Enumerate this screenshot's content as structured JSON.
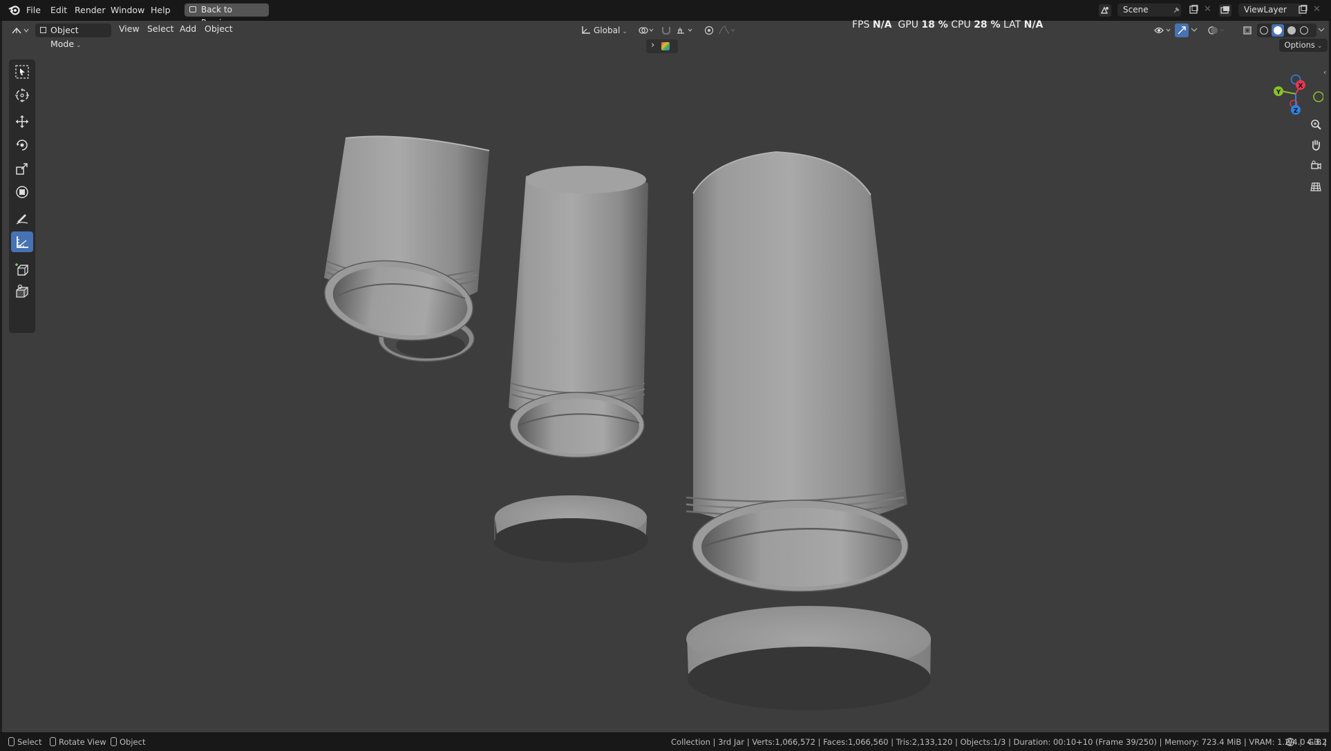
{
  "menubar": {
    "app_icon": "blender-logo-icon",
    "items": [
      "File",
      "Edit",
      "Render",
      "Window",
      "Help"
    ],
    "back_button": "Back to Previous",
    "scene_label": "Scene",
    "view_layer_label": "ViewLayer"
  },
  "viewport_header": {
    "editor_icon": "view3d-editor-icon",
    "mode": "Object Mode",
    "menus": [
      "View",
      "Select",
      "Add",
      "Object"
    ],
    "orientation": "Global",
    "options_label": "Options"
  },
  "stats": {
    "fps_label": "FPS",
    "fps_value": "N/A",
    "gpu_label": "GPU",
    "gpu_value": "18 %",
    "cpu_label": "CPU",
    "cpu_value": "28 %",
    "lat_label": "LAT",
    "lat_value": "N/A"
  },
  "gizmo": {
    "x_label": "X",
    "y_label": "Y",
    "z_label": "Z",
    "x_color": "#e8374f",
    "y_color": "#8bc02b",
    "z_color": "#2f82e0"
  },
  "toolbar": {
    "tools": [
      "select-box-icon",
      "cursor-icon",
      "move-icon",
      "rotate-icon",
      "scale-icon",
      "transform-icon",
      "annotate-icon",
      "measure-icon",
      "add-cube-icon",
      "extrude-icon"
    ],
    "active_tool": "measure-icon",
    "accent": "#4772b3"
  },
  "statusbar": {
    "select_label": "Select",
    "rotate_label": "Rotate View",
    "object_label": "Object",
    "info": "Collection | 3rd Jar | Verts:1,066,572 | Faces:1,066,560 | Tris:2,133,120 | Objects:1/3 | Duration: 00:10+10 (Frame 39/250) | Memory: 723.4 MiB | VRAM: 1.2/4.0 GiB |",
    "version": "4.3.2"
  }
}
